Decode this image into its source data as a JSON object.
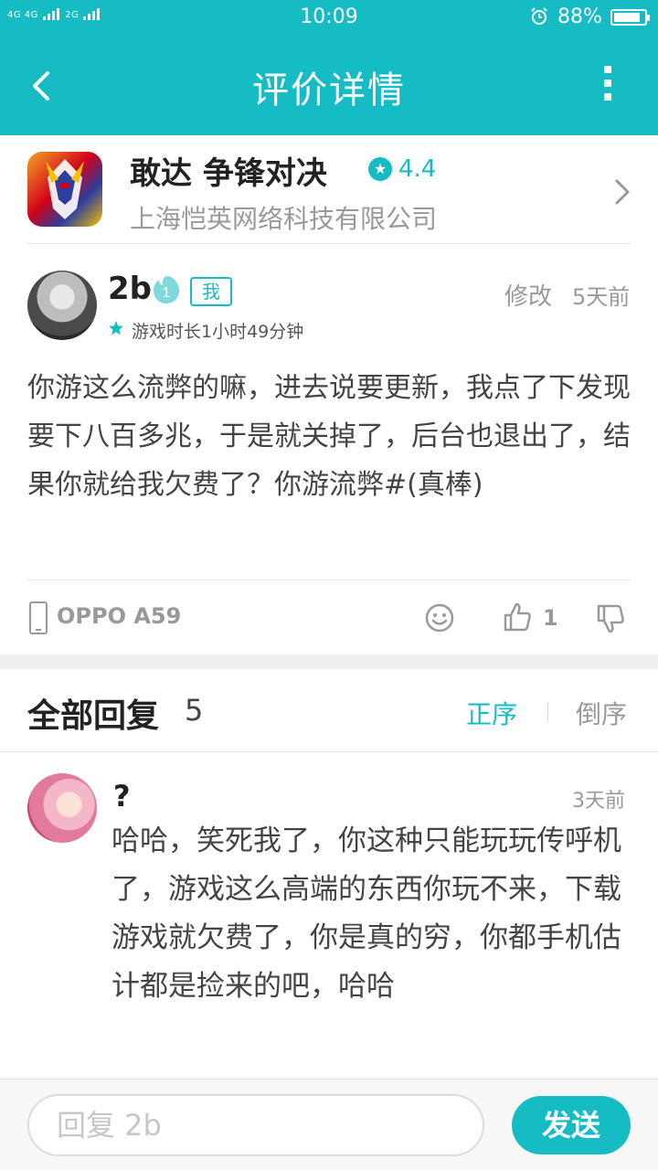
{
  "status_bar": {
    "network_1": "4G 4G",
    "network_2": "2G",
    "time": "10:09",
    "battery_percent": "88%",
    "battery_level": 0.88
  },
  "header": {
    "title": "评价详情",
    "back_icon": "chevron-left-icon",
    "more_icon": "more-vertical-icon",
    "color": "#16bcc4"
  },
  "app": {
    "name": "敢达 争锋对决",
    "rating": "4.4",
    "developer": "上海恺英网络科技有限公司"
  },
  "review": {
    "username": "2b",
    "level": "1",
    "me_tag": "我",
    "edit_label": "修改",
    "time": "5天前",
    "playtime": "游戏时长1小时49分钟",
    "body": "你游这么流弊的嘛，进去说要更新，我点了下发现要下八百多兆，于是就关掉了，后台也退出了，结果你就给我欠费了？你游流弊#(真棒)",
    "device": "OPPO A59",
    "like_count": "1"
  },
  "replies": {
    "title": "全部回复",
    "count": "5",
    "sort_asc": "正序",
    "sort_desc": "倒序",
    "items": [
      {
        "username": "?",
        "time": "3天前",
        "body": "哈哈，笑死我了，你这种只能玩玩传呼机了，游戏这么高端的东西你玩不来，下载游戏就欠费了，你是真的穷，你都手机估计都是捡来的吧，哈哈"
      }
    ]
  },
  "reply_bar": {
    "placeholder": "回复 2b",
    "send_label": "发送"
  }
}
